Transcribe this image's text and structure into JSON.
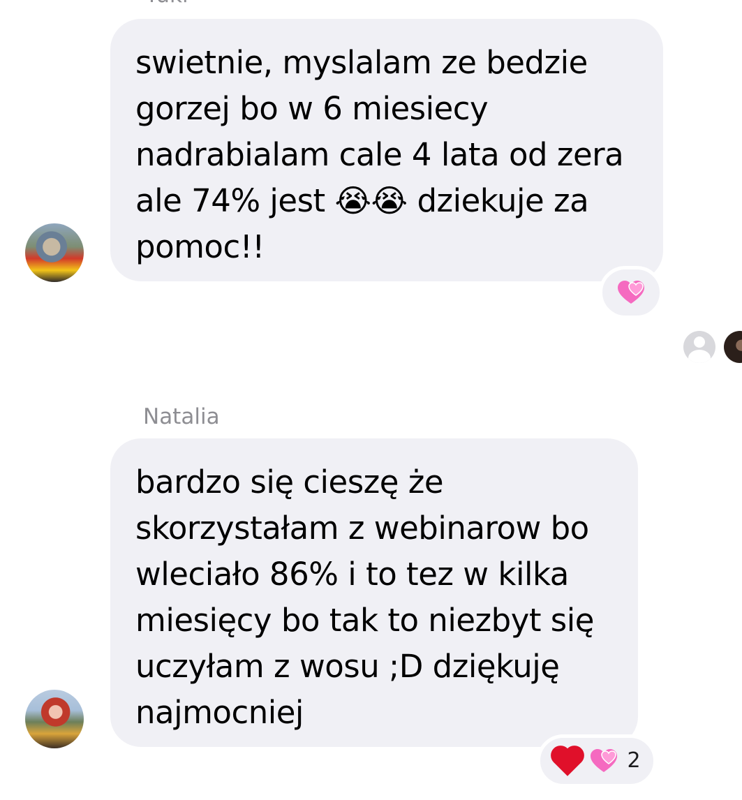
{
  "messages": [
    {
      "sender": "Yuki",
      "text": "swietnie, myslalam ze bedzie\ngorzej bo w 6 miesiecy\nnadrabialam cale 4 lata od zera\nale 74% jest 😭😭 dziekuje za\npomoc!!",
      "avatar": "sender-avatar-photo",
      "reactions": [
        {
          "icon": "revolving-hearts-icon",
          "emoji": "💞"
        }
      ],
      "reaction_count": ""
    },
    {
      "sender": "Natalia",
      "text": "bardzo się cieszę że\nskorzystałam z webinarow bo\nwleciało 86% i to tez w kilka\nmiesięcy bo tak to niezbyt się\nuczyłam z wosu ;D dziękuję\nnajmocniej",
      "avatar": "sender-avatar-photo",
      "reactions": [
        {
          "icon": "red-heart-icon",
          "emoji": "❤️"
        },
        {
          "icon": "revolving-hearts-icon",
          "emoji": "💞"
        }
      ],
      "reaction_count": "2"
    }
  ],
  "seen_by": [
    {
      "icon": "default-user-avatar-icon"
    },
    {
      "icon": "user-photo-avatar"
    }
  ],
  "colors": {
    "bubble": "#f0f0f5",
    "sender_name": "#8e8e93",
    "text": "#000000",
    "background": "#ffffff"
  }
}
